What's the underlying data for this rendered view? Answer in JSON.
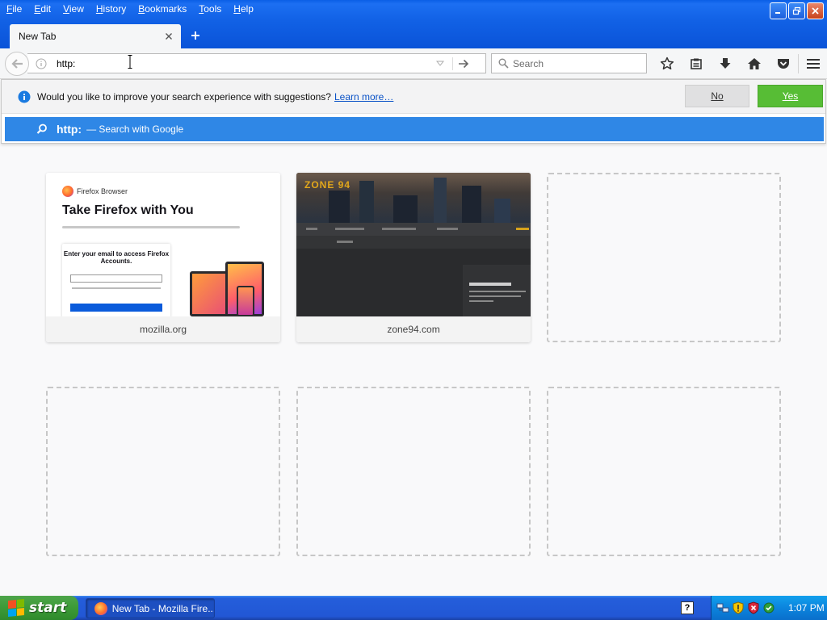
{
  "menu": [
    "File",
    "Edit",
    "View",
    "History",
    "Bookmarks",
    "Tools",
    "Help"
  ],
  "tab": {
    "title": "New Tab"
  },
  "urlbar": {
    "value": "http:"
  },
  "search": {
    "placeholder": "Search"
  },
  "notice": {
    "text": "Would you like to improve your search experience with suggestions?",
    "link": "Learn more…",
    "no": "No",
    "yes": "Yes"
  },
  "result": {
    "url": "http:",
    "action": "— Search with Google"
  },
  "tiles": [
    {
      "label": "mozilla.org",
      "brand": "Firefox Browser",
      "headline": "Take Firefox with You",
      "card": "Enter your email to access Firefox Accounts."
    },
    {
      "label": "zone94.com",
      "logo": "ZONE 94"
    }
  ],
  "taskbar": {
    "start": "start",
    "task": "New Tab - Mozilla Fire...",
    "help": "?",
    "time": "1:07 PM"
  },
  "colors": {
    "accent": "#2f87e6",
    "yes": "#57bd35",
    "taskbar": "#245edb"
  }
}
